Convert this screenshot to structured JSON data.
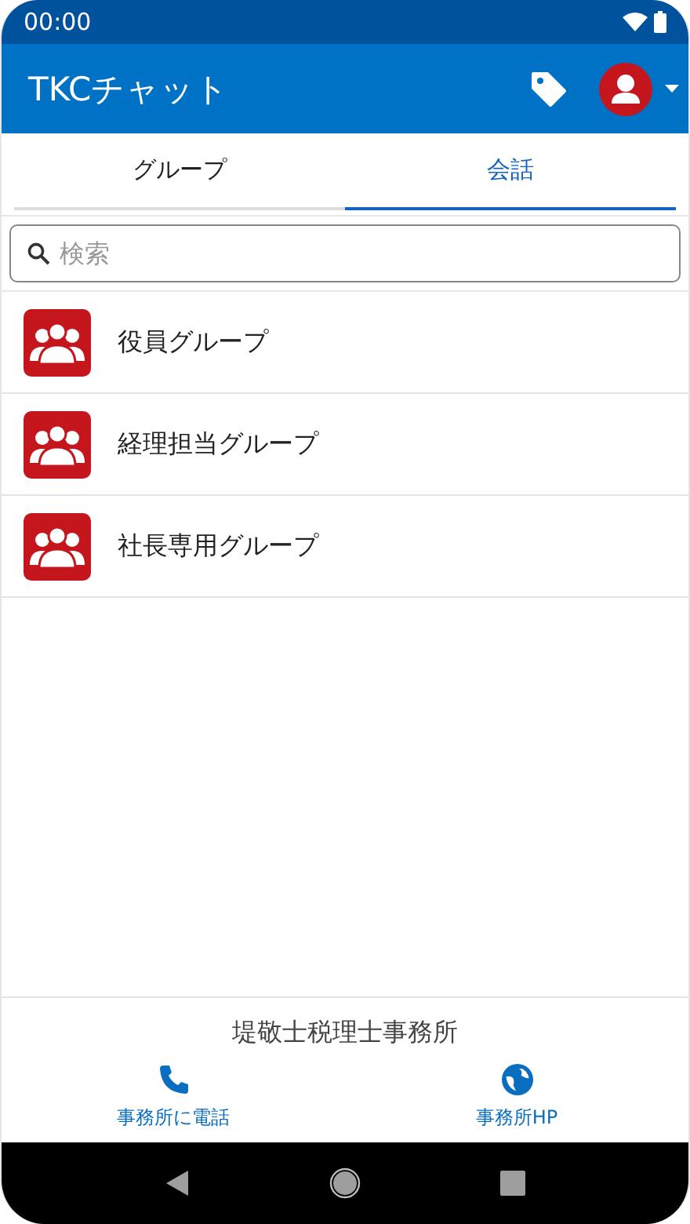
{
  "status_bar": {
    "time": "00:00"
  },
  "app_bar": {
    "title": "TKCチャット"
  },
  "tabs": [
    {
      "label": "グループ",
      "selected": false
    },
    {
      "label": "会話",
      "selected": true
    }
  ],
  "search": {
    "placeholder": "検索"
  },
  "groups": [
    {
      "name": "役員グループ"
    },
    {
      "name": "経理担当グループ"
    },
    {
      "name": "社長専用グループ"
    }
  ],
  "footer": {
    "office": "堤敬士税理士事務所",
    "actions": [
      {
        "kind": "phone",
        "label": "事務所に電話"
      },
      {
        "kind": "web",
        "label": "事務所HP"
      }
    ]
  }
}
